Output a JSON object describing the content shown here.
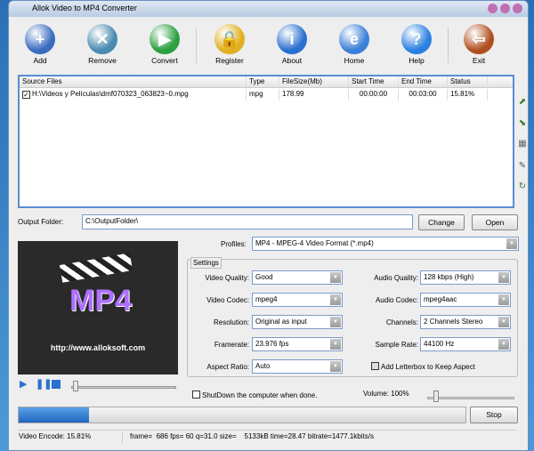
{
  "window": {
    "title": "Allok Video to MP4 Converter"
  },
  "toolbar": [
    {
      "label": "Add",
      "icon": "folder-add-icon",
      "color": "#3a6cc0",
      "glyph": "+"
    },
    {
      "label": "Remove",
      "icon": "trash-icon",
      "color": "#4a8ab0",
      "glyph": "✕"
    },
    {
      "label": "Convert",
      "icon": "play-convert-icon",
      "color": "#2aa040",
      "glyph": "▶"
    },
    {
      "label": "Register",
      "icon": "lock-icon",
      "color": "#e0b020",
      "glyph": "🔒"
    },
    {
      "label": "About",
      "icon": "info-icon",
      "color": "#2a70d0",
      "glyph": "i"
    },
    {
      "label": "Home",
      "icon": "globe-icon",
      "color": "#3a80d8",
      "glyph": "e"
    },
    {
      "label": "Help",
      "icon": "help-icon",
      "color": "#2a80e0",
      "glyph": "?"
    },
    {
      "label": "Exit",
      "icon": "exit-door-icon",
      "color": "#b05020",
      "glyph": "⇦"
    }
  ],
  "list": {
    "headers": [
      "Source Files",
      "Type",
      "FileSize(Mb)",
      "Start Time",
      "End Time",
      "Status"
    ],
    "rows": [
      {
        "file": "H:\\Videos y Películas\\dmf070323_063823~0.mpg",
        "type": "mpg",
        "size": "178.99",
        "start": "00:00:00",
        "end": "00:03:00",
        "status": "15.81%"
      }
    ]
  },
  "output": {
    "label": "Output Folder:",
    "value": "C:\\OutputFolder\\",
    "change": "Change",
    "open": "Open"
  },
  "preview": {
    "logo": "MP4",
    "url": "http://www.alloksoft.com"
  },
  "profiles": {
    "label": "Profiles:",
    "value": "MP4 - MPEG-4 Video Format (*.mp4)"
  },
  "settings": {
    "title": "Settings",
    "video_quality": {
      "label": "Video Quality:",
      "value": "Good"
    },
    "video_codec": {
      "label": "Video Codec:",
      "value": "mpeg4"
    },
    "resolution": {
      "label": "Resolution:",
      "value": "Original as input"
    },
    "framerate": {
      "label": "Framerate:",
      "value": "23.976 fps"
    },
    "aspect": {
      "label": "Aspect Ratio:",
      "value": "Auto"
    },
    "audio_quality": {
      "label": "Audio Quality:",
      "value": "128 kbps (High)"
    },
    "audio_codec": {
      "label": "Audio Codec:",
      "value": "mpeg4aac"
    },
    "channels": {
      "label": "Channels:",
      "value": "2 Channels Stereo"
    },
    "sample_rate": {
      "label": "Sample Rate:",
      "value": "44100 Hz"
    },
    "letterbox": "Add Letterbox to Keep Aspect"
  },
  "shutdown": "ShutDown the computer when done.",
  "volume": {
    "label": "Volume: 100%",
    "value": 100
  },
  "progress": {
    "percent": 15.81,
    "stop": "Stop"
  },
  "status": {
    "encode": "Video Encode: 15.81%",
    "details": "frame=  686 fps= 60 q=31.0 size=    5133kB time=28.47 bitrate=1477.1kbits/s"
  }
}
